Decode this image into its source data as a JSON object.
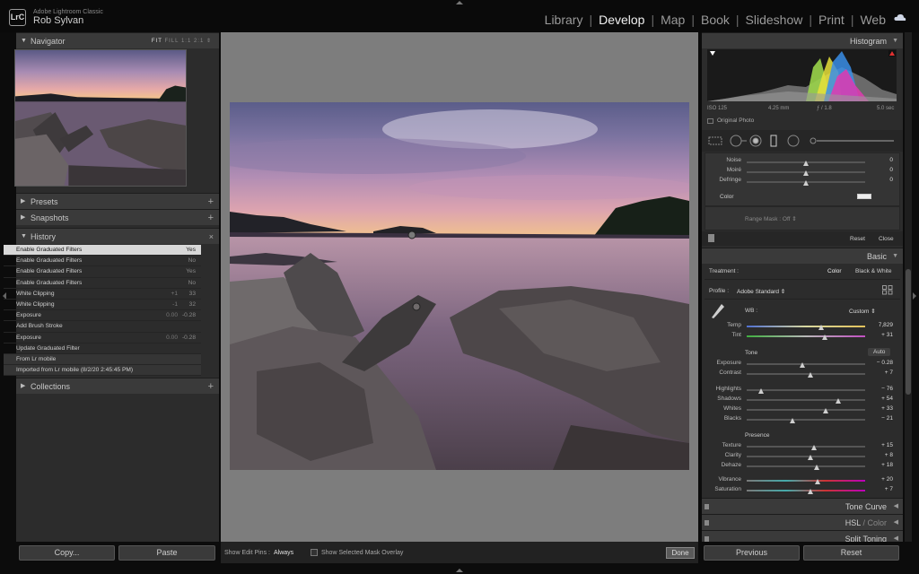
{
  "app": {
    "product": "Adobe Lightroom Classic",
    "user": "Rob Sylvan",
    "logo": "LrC"
  },
  "modules": [
    "Library",
    "Develop",
    "Map",
    "Book",
    "Slideshow",
    "Print",
    "Web"
  ],
  "active_module": "Develop",
  "left_panel": {
    "navigator": {
      "title": "Navigator",
      "zoom_options": [
        "FIT",
        "FILL",
        "1:1",
        "2:1"
      ],
      "selected_zoom": "FIT"
    },
    "presets": {
      "title": "Presets"
    },
    "snapshots": {
      "title": "Snapshots"
    },
    "history": {
      "title": "History",
      "items": [
        {
          "label": "Enable Graduated Filters",
          "v1": "",
          "v2": "Yes"
        },
        {
          "label": "Enable Graduated Filters",
          "v1": "",
          "v2": "No"
        },
        {
          "label": "Enable Graduated Filters",
          "v1": "",
          "v2": "Yes"
        },
        {
          "label": "Enable Graduated Filters",
          "v1": "",
          "v2": "No"
        },
        {
          "label": "White Clipping",
          "v1": "+1",
          "v2": "33"
        },
        {
          "label": "White Clipping",
          "v1": "-1",
          "v2": "32"
        },
        {
          "label": "Exposure",
          "v1": "0.00",
          "v2": "-0.28"
        },
        {
          "label": "Add Brush Stroke",
          "v1": "",
          "v2": ""
        },
        {
          "label": "Exposure",
          "v1": "0.00",
          "v2": "-0.28"
        },
        {
          "label": "Update Graduated Filter",
          "v1": "",
          "v2": ""
        },
        {
          "label": "From Lr mobile",
          "v1": "",
          "v2": ""
        },
        {
          "label": "Imported from Lr mobile (8/2/20 2:45:45 PM)",
          "v1": "",
          "v2": ""
        }
      ]
    },
    "collections": {
      "title": "Collections"
    },
    "copy_label": "Copy...",
    "paste_label": "Paste"
  },
  "toolbar": {
    "show_edit_pins_label": "Show Edit Pins :",
    "show_edit_pins_value": "Always",
    "mask_overlay_label": "Show Selected Mask Overlay",
    "done_label": "Done"
  },
  "right_panel": {
    "histogram": {
      "title": "Histogram",
      "iso": "ISO 125",
      "focal": "4.25 mm",
      "aperture": "ƒ / 1.8",
      "shutter": "5.0 sec",
      "original_photo": "Original Photo"
    },
    "detail": {
      "noise": {
        "label": "Noise",
        "value": "0"
      },
      "moire": {
        "label": "Moiré",
        "value": "0"
      },
      "defringe": {
        "label": "Defringe",
        "value": "0"
      },
      "color_label": "Color",
      "range_mask": "Range Mask : Off ⇕",
      "reset": "Reset",
      "close": "Close"
    },
    "basic": {
      "title": "Basic",
      "treatment_label": "Treatment :",
      "treatment_color": "Color",
      "treatment_bw": "Black & White",
      "profile_label": "Profile :",
      "profile_value": "Adobe Standard ⇕",
      "wb_label": "WB :",
      "wb_value": "Custom ⇕",
      "tone_label": "Tone",
      "auto_label": "Auto",
      "presence_label": "Presence",
      "sliders": {
        "temp": {
          "label": "Temp",
          "value": "7,829",
          "pos": 0.63
        },
        "tint": {
          "label": "Tint",
          "value": "+ 31",
          "pos": 0.66
        },
        "exposure": {
          "label": "Exposure",
          "value": "− 0.28",
          "pos": 0.47
        },
        "contrast": {
          "label": "Contrast",
          "value": "+ 7",
          "pos": 0.54
        },
        "highlights": {
          "label": "Highlights",
          "value": "− 76",
          "pos": 0.12
        },
        "shadows": {
          "label": "Shadows",
          "value": "+ 54",
          "pos": 0.77
        },
        "whites": {
          "label": "Whites",
          "value": "+ 33",
          "pos": 0.67
        },
        "blacks": {
          "label": "Blacks",
          "value": "− 21",
          "pos": 0.39
        },
        "texture": {
          "label": "Texture",
          "value": "+ 15",
          "pos": 0.57
        },
        "clarity": {
          "label": "Clarity",
          "value": "+ 8",
          "pos": 0.54
        },
        "dehaze": {
          "label": "Dehaze",
          "value": "+ 18",
          "pos": 0.59
        },
        "vibrance": {
          "label": "Vibrance",
          "value": "+ 20",
          "pos": 0.6
        },
        "saturation": {
          "label": "Saturation",
          "value": "+ 7",
          "pos": 0.54
        }
      }
    },
    "tone_curve": "Tone Curve",
    "hsl_a": "HSL",
    "hsl_b": "Color",
    "split_toning": "Split Toning",
    "previous_label": "Previous",
    "reset_label": "Reset"
  },
  "colors": {
    "accent": "#f0f0f0",
    "panel": "#2c2c2c",
    "header": "#3a3a3a"
  }
}
